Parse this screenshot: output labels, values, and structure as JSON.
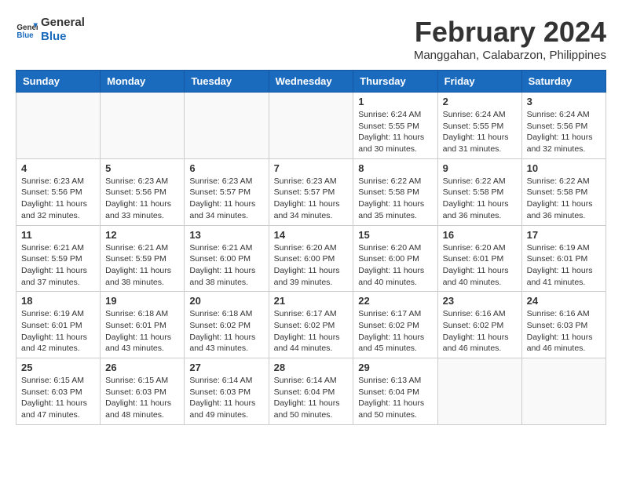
{
  "header": {
    "logo_general": "General",
    "logo_blue": "Blue",
    "month_year": "February 2024",
    "location": "Manggahan, Calabarzon, Philippines"
  },
  "days_of_week": [
    "Sunday",
    "Monday",
    "Tuesday",
    "Wednesday",
    "Thursday",
    "Friday",
    "Saturday"
  ],
  "weeks": [
    [
      {
        "day": "",
        "info": ""
      },
      {
        "day": "",
        "info": ""
      },
      {
        "day": "",
        "info": ""
      },
      {
        "day": "",
        "info": ""
      },
      {
        "day": "1",
        "info": "Sunrise: 6:24 AM\nSunset: 5:55 PM\nDaylight: 11 hours and 30 minutes."
      },
      {
        "day": "2",
        "info": "Sunrise: 6:24 AM\nSunset: 5:55 PM\nDaylight: 11 hours and 31 minutes."
      },
      {
        "day": "3",
        "info": "Sunrise: 6:24 AM\nSunset: 5:56 PM\nDaylight: 11 hours and 32 minutes."
      }
    ],
    [
      {
        "day": "4",
        "info": "Sunrise: 6:23 AM\nSunset: 5:56 PM\nDaylight: 11 hours and 32 minutes."
      },
      {
        "day": "5",
        "info": "Sunrise: 6:23 AM\nSunset: 5:56 PM\nDaylight: 11 hours and 33 minutes."
      },
      {
        "day": "6",
        "info": "Sunrise: 6:23 AM\nSunset: 5:57 PM\nDaylight: 11 hours and 34 minutes."
      },
      {
        "day": "7",
        "info": "Sunrise: 6:23 AM\nSunset: 5:57 PM\nDaylight: 11 hours and 34 minutes."
      },
      {
        "day": "8",
        "info": "Sunrise: 6:22 AM\nSunset: 5:58 PM\nDaylight: 11 hours and 35 minutes."
      },
      {
        "day": "9",
        "info": "Sunrise: 6:22 AM\nSunset: 5:58 PM\nDaylight: 11 hours and 36 minutes."
      },
      {
        "day": "10",
        "info": "Sunrise: 6:22 AM\nSunset: 5:58 PM\nDaylight: 11 hours and 36 minutes."
      }
    ],
    [
      {
        "day": "11",
        "info": "Sunrise: 6:21 AM\nSunset: 5:59 PM\nDaylight: 11 hours and 37 minutes."
      },
      {
        "day": "12",
        "info": "Sunrise: 6:21 AM\nSunset: 5:59 PM\nDaylight: 11 hours and 38 minutes."
      },
      {
        "day": "13",
        "info": "Sunrise: 6:21 AM\nSunset: 6:00 PM\nDaylight: 11 hours and 38 minutes."
      },
      {
        "day": "14",
        "info": "Sunrise: 6:20 AM\nSunset: 6:00 PM\nDaylight: 11 hours and 39 minutes."
      },
      {
        "day": "15",
        "info": "Sunrise: 6:20 AM\nSunset: 6:00 PM\nDaylight: 11 hours and 40 minutes."
      },
      {
        "day": "16",
        "info": "Sunrise: 6:20 AM\nSunset: 6:01 PM\nDaylight: 11 hours and 40 minutes."
      },
      {
        "day": "17",
        "info": "Sunrise: 6:19 AM\nSunset: 6:01 PM\nDaylight: 11 hours and 41 minutes."
      }
    ],
    [
      {
        "day": "18",
        "info": "Sunrise: 6:19 AM\nSunset: 6:01 PM\nDaylight: 11 hours and 42 minutes."
      },
      {
        "day": "19",
        "info": "Sunrise: 6:18 AM\nSunset: 6:01 PM\nDaylight: 11 hours and 43 minutes."
      },
      {
        "day": "20",
        "info": "Sunrise: 6:18 AM\nSunset: 6:02 PM\nDaylight: 11 hours and 43 minutes."
      },
      {
        "day": "21",
        "info": "Sunrise: 6:17 AM\nSunset: 6:02 PM\nDaylight: 11 hours and 44 minutes."
      },
      {
        "day": "22",
        "info": "Sunrise: 6:17 AM\nSunset: 6:02 PM\nDaylight: 11 hours and 45 minutes."
      },
      {
        "day": "23",
        "info": "Sunrise: 6:16 AM\nSunset: 6:02 PM\nDaylight: 11 hours and 46 minutes."
      },
      {
        "day": "24",
        "info": "Sunrise: 6:16 AM\nSunset: 6:03 PM\nDaylight: 11 hours and 46 minutes."
      }
    ],
    [
      {
        "day": "25",
        "info": "Sunrise: 6:15 AM\nSunset: 6:03 PM\nDaylight: 11 hours and 47 minutes."
      },
      {
        "day": "26",
        "info": "Sunrise: 6:15 AM\nSunset: 6:03 PM\nDaylight: 11 hours and 48 minutes."
      },
      {
        "day": "27",
        "info": "Sunrise: 6:14 AM\nSunset: 6:03 PM\nDaylight: 11 hours and 49 minutes."
      },
      {
        "day": "28",
        "info": "Sunrise: 6:14 AM\nSunset: 6:04 PM\nDaylight: 11 hours and 50 minutes."
      },
      {
        "day": "29",
        "info": "Sunrise: 6:13 AM\nSunset: 6:04 PM\nDaylight: 11 hours and 50 minutes."
      },
      {
        "day": "",
        "info": ""
      },
      {
        "day": "",
        "info": ""
      }
    ]
  ]
}
